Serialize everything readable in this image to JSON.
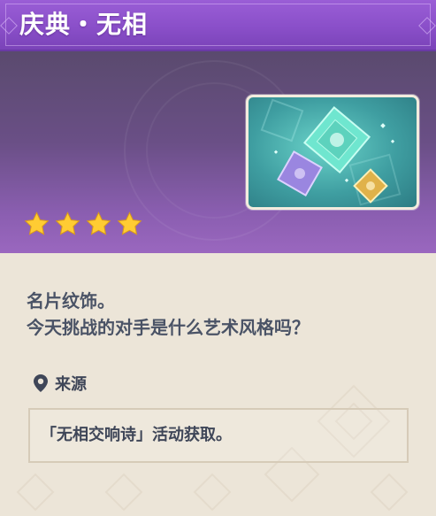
{
  "card": {
    "title": "庆典・无相",
    "rarity_stars": 4,
    "description_lines": [
      "名片纹饰。",
      "今天挑战的对手是什么艺术风格吗？"
    ],
    "source_heading": "来源",
    "source_text": "「无相交响诗」活动获取。"
  },
  "icons": {
    "star": "star-icon",
    "location": "location-pin-icon"
  },
  "colors": {
    "title_bar": "#8a4fc9",
    "banner_top": "#5a4a6e",
    "banner_bottom": "#9a67bf",
    "star": "#ffcc33",
    "body_bg": "#ece5d8",
    "text": "#4a5366"
  }
}
